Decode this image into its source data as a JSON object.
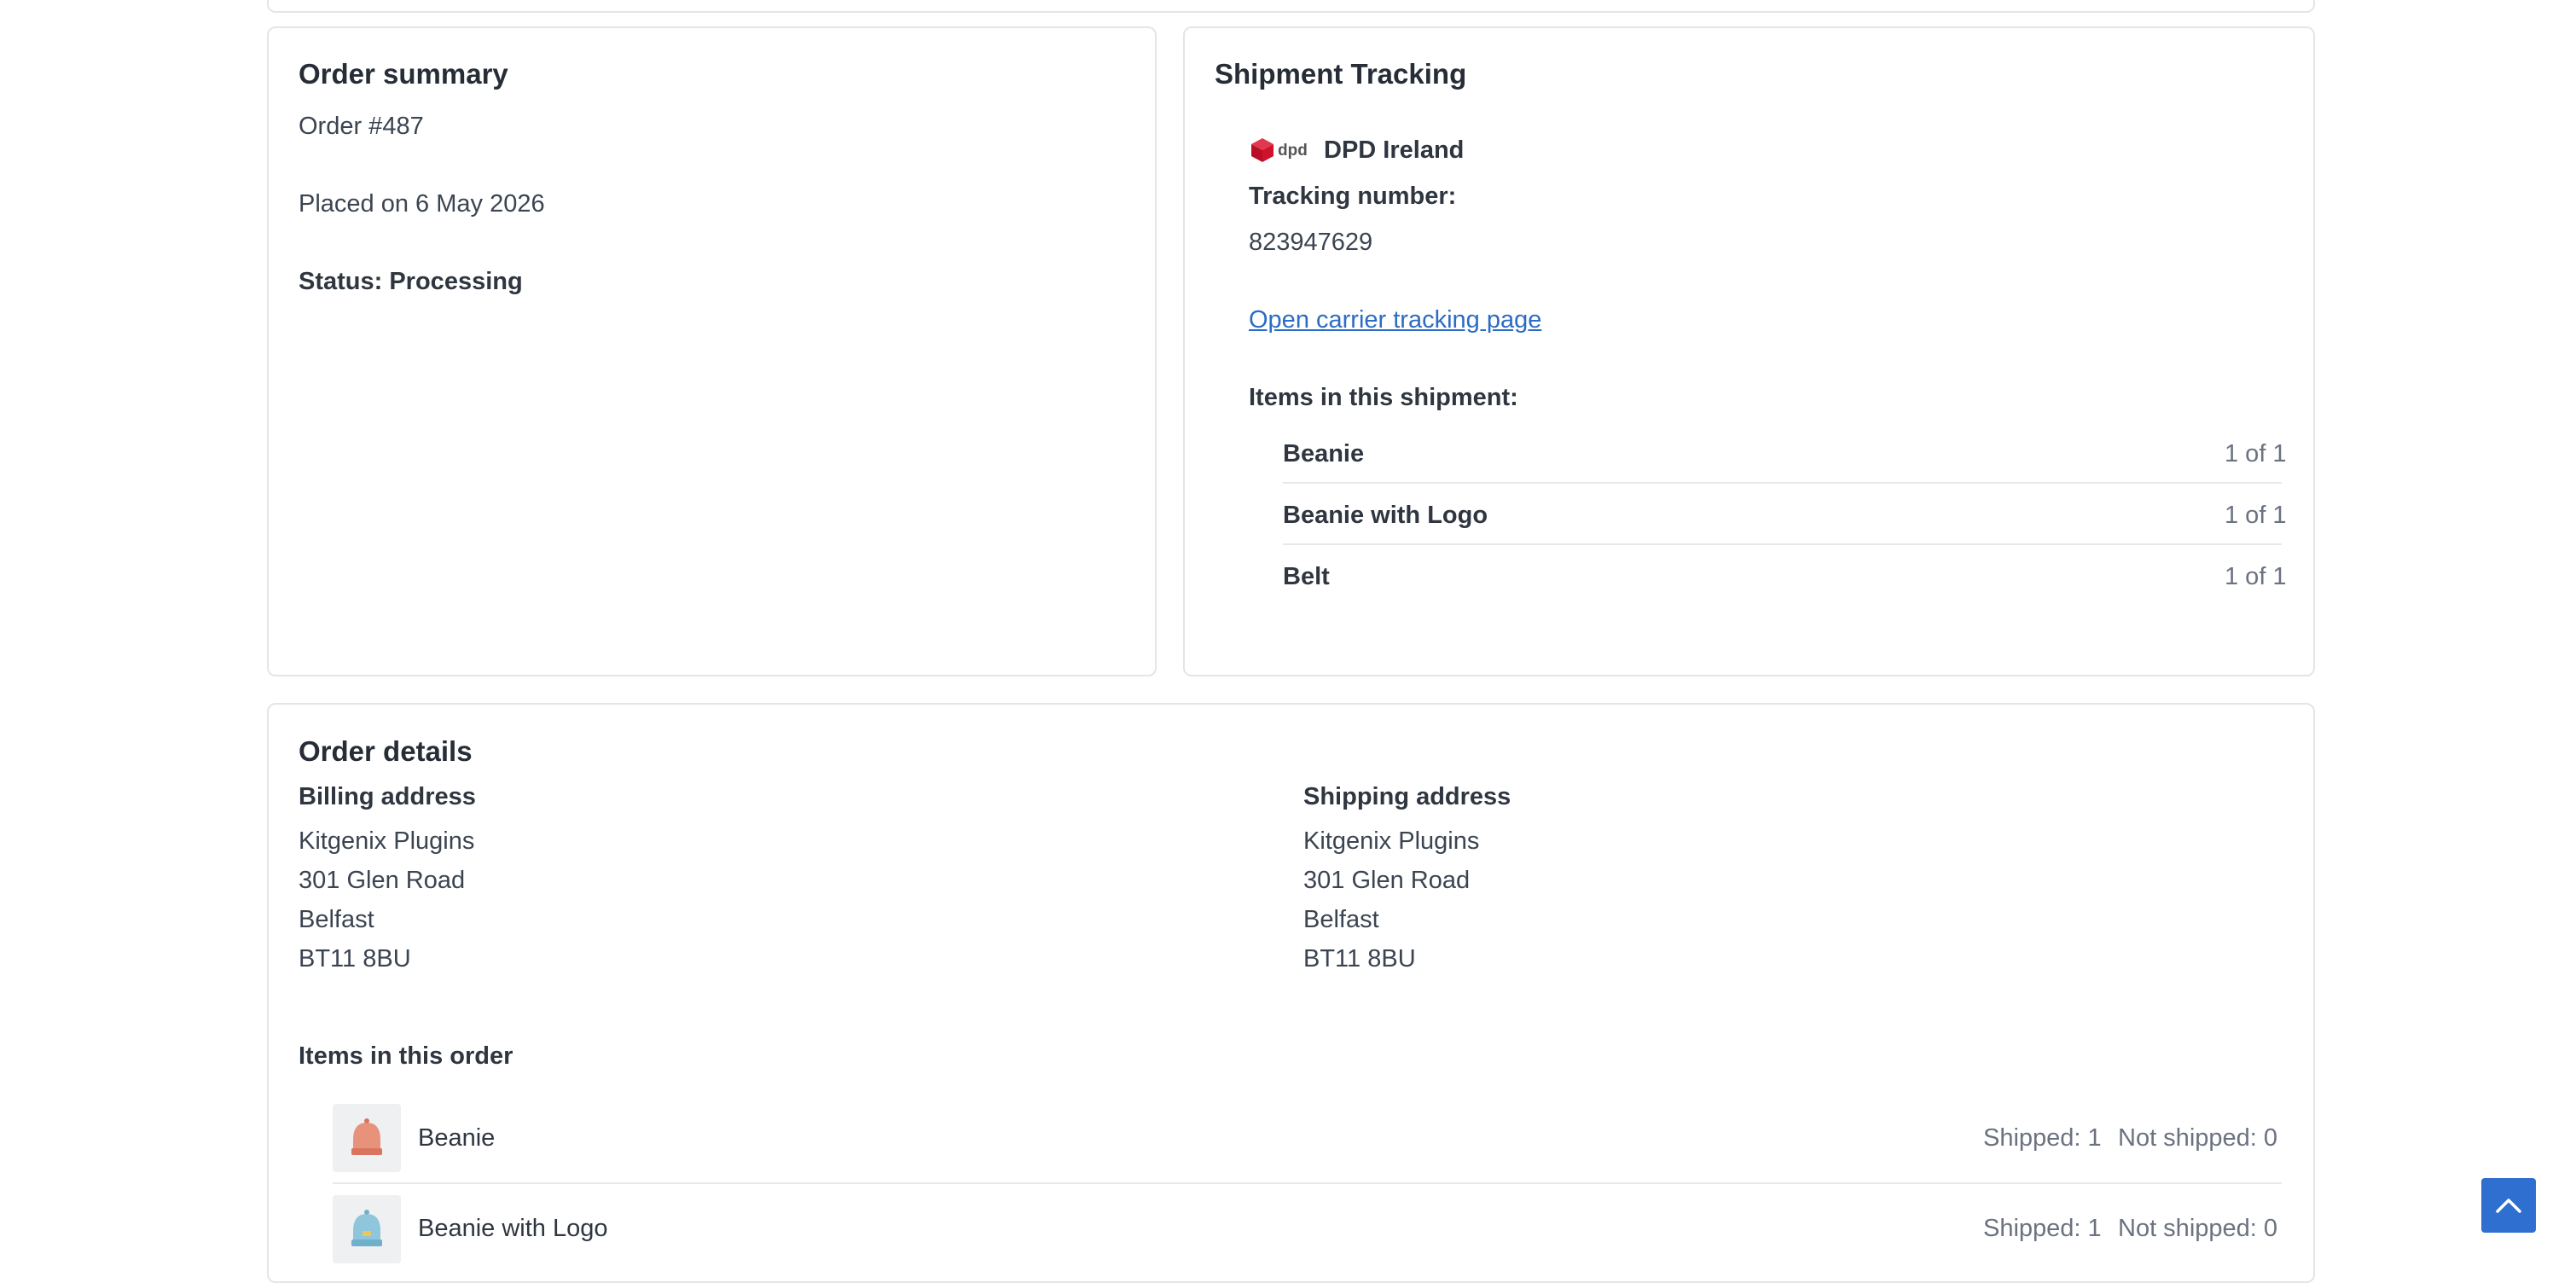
{
  "order_summary": {
    "title": "Order summary",
    "order_number": "Order #487",
    "placed_on": "Placed on 6 May 2026",
    "status": "Status: Processing"
  },
  "shipment": {
    "title": "Shipment Tracking",
    "carrier_logo_text": "dpd",
    "carrier_name": "DPD Ireland",
    "tracking_label": "Tracking number:",
    "tracking_number": "823947629",
    "tracking_link": "Open carrier tracking page",
    "items_label": "Items in this shipment:",
    "items": [
      {
        "name": "Beanie",
        "qty": "1 of 1"
      },
      {
        "name": "Beanie with Logo",
        "qty": "1 of 1"
      },
      {
        "name": "Belt",
        "qty": "1 of 1"
      }
    ]
  },
  "order_details": {
    "title": "Order details",
    "billing": {
      "heading": "Billing address",
      "lines": [
        "Kitgenix Plugins",
        "301 Glen Road",
        "Belfast",
        "BT11 8BU"
      ]
    },
    "shipping": {
      "heading": "Shipping address",
      "lines": [
        "Kitgenix Plugins",
        "301 Glen Road",
        "Belfast",
        "BT11 8BU"
      ]
    },
    "items_heading": "Items in this order",
    "items": [
      {
        "name": "Beanie",
        "shipped": "Shipped: 1",
        "not_shipped": "Not shipped: 0"
      },
      {
        "name": "Beanie with Logo",
        "shipped": "Shipped: 1",
        "not_shipped": "Not shipped: 0"
      }
    ]
  },
  "colors": {
    "accent": "#2f6fd0",
    "link": "#2b6cc4",
    "dpd_red": "#d0112b"
  },
  "icons": {
    "carrier_logo": "dpd-cube-icon",
    "back_to_top": "chevron-up-icon"
  }
}
